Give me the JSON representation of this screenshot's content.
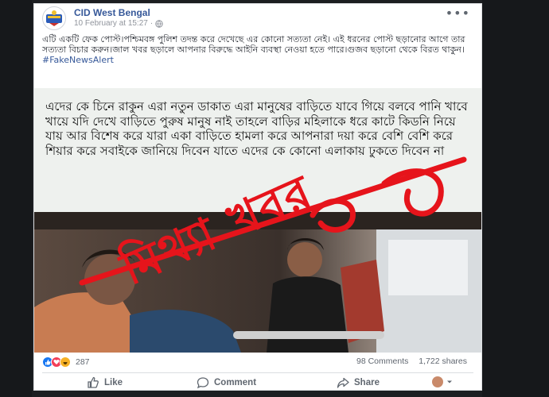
{
  "post": {
    "page_name": "CID West Bengal",
    "date": "10 February at 15:27",
    "dot": "·",
    "more": "•••",
    "text": "এটি একটি ফেক পোস্ট।পশ্চিমবঙ্গ পুলিশ তদন্ত করে দেখেছে এর কোনো সত্যতা নেই। এই ধরনের পোস্ট ছড়ানোর আগে তার সত্যতা বিচার করুন।জাল খবর ছড়ালে আপনার বিরুদ্ধে আইনি ব্যবস্থা নেওয়া হতে পারে।গুজব ছড়ানো থেকে বিরত থাকুন।",
    "hashtag": "#FakeNewsAlert"
  },
  "image": {
    "overlay_text": "এদের কে চিনে রাকুন এরা নতুন ডাকাত এরা মানুষের বাড়িতে যাবে গিয়ে বলবে পানি খাবে খায়ে যদি দেখে বাড়িতে পুরুষ মানুষ নাই তাহলে বাড়ির মহিলাকে ধরে কাটে কিডনি নিয়ে যায় আর বিশেষ করে যারা একা বাড়িতে হামলা করে আপনারা দয়া করে বেশি বেশি করে শিয়ার করে সবাইকে জানিয়ে দিবেন যাতে এদের কে কোনো এলাকায় ঢুকতে দিবেন না",
    "stamp": "মিথ্যা খবর",
    "stamp_color": "#e6141b"
  },
  "stats": {
    "reaction_count": "287",
    "comments": "98 Comments",
    "shares": "1,722 shares"
  },
  "actions": {
    "like": "Like",
    "comment": "Comment",
    "share": "Share"
  },
  "colors": {
    "link": "#365899",
    "like_blue": "#1877f2",
    "love_red": "#f33e58",
    "haha_yellow": "#f7b125"
  }
}
